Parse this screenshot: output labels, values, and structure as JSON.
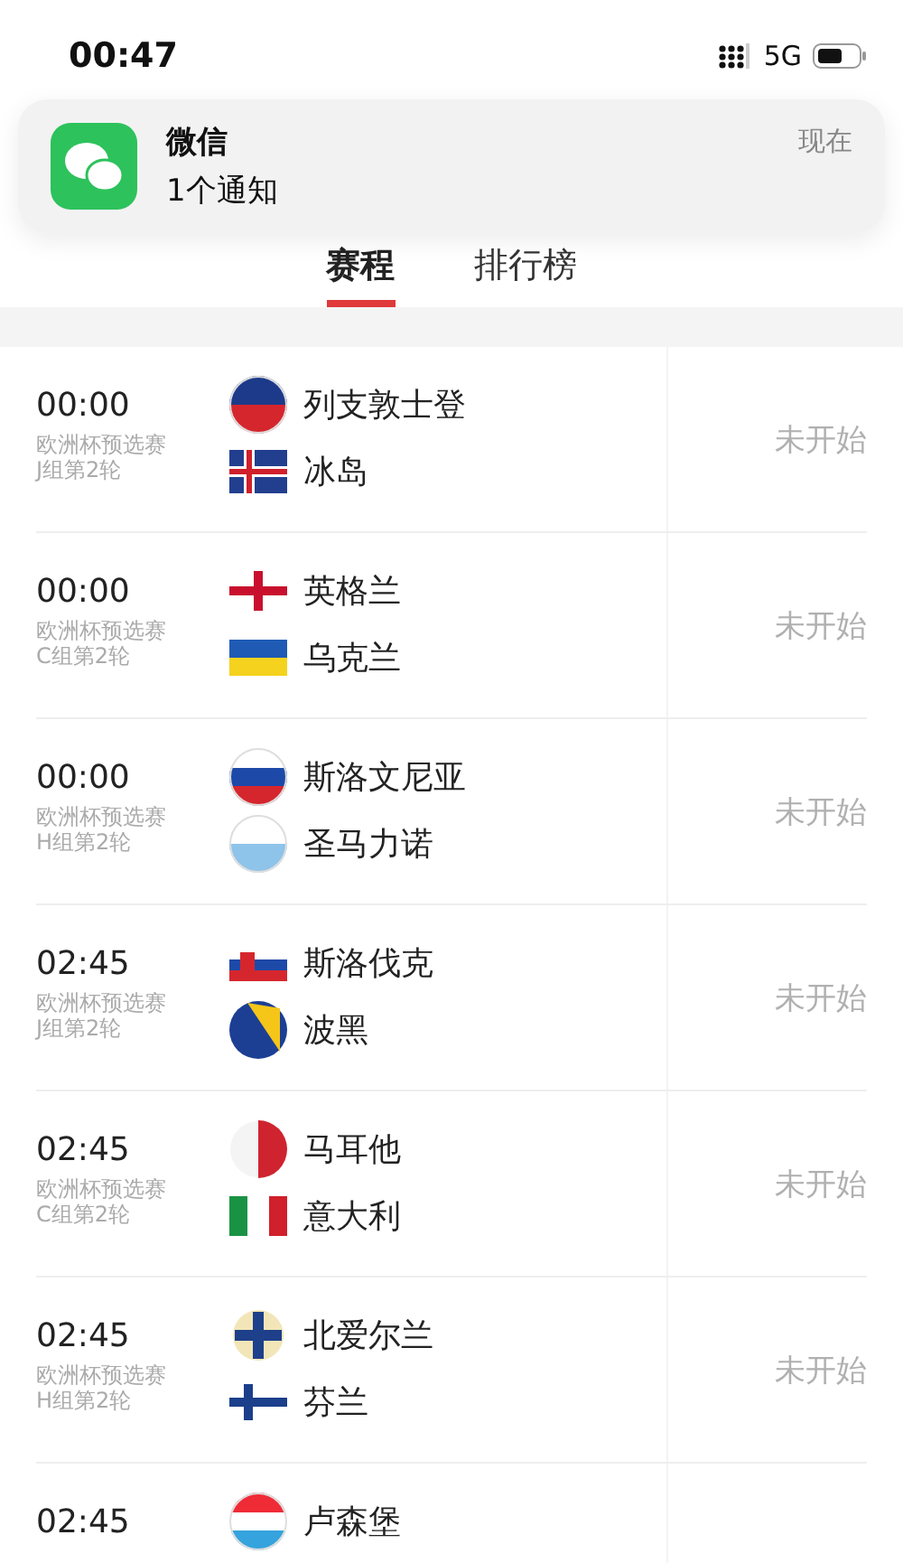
{
  "status_bar": {
    "time": "00:47",
    "network": "5G"
  },
  "notification": {
    "app": "微信",
    "message": "1个通知",
    "time": "现在"
  },
  "tabs": [
    {
      "label": "赛程",
      "selected": true
    },
    {
      "label": "排行榜",
      "selected": false
    }
  ],
  "matches": [
    {
      "time": "00:00",
      "league": "欧洲杯预选赛",
      "round": "J组第2轮",
      "teams": [
        "列支敦士登",
        "冰岛"
      ],
      "status": "未开始"
    },
    {
      "time": "00:00",
      "league": "欧洲杯预选赛",
      "round": "C组第2轮",
      "teams": [
        "英格兰",
        "乌克兰"
      ],
      "status": "未开始"
    },
    {
      "time": "00:00",
      "league": "欧洲杯预选赛",
      "round": "H组第2轮",
      "teams": [
        "斯洛文尼亚",
        "圣马力诺"
      ],
      "status": "未开始"
    },
    {
      "time": "02:45",
      "league": "欧洲杯预选赛",
      "round": "J组第2轮",
      "teams": [
        "斯洛伐克",
        "波黑"
      ],
      "status": "未开始"
    },
    {
      "time": "02:45",
      "league": "欧洲杯预选赛",
      "round": "C组第2轮",
      "teams": [
        "马耳他",
        "意大利"
      ],
      "status": "未开始"
    },
    {
      "time": "02:45",
      "league": "欧洲杯预选赛",
      "round": "H组第2轮",
      "teams": [
        "北爱尔兰",
        "芬兰"
      ],
      "status": "未开始"
    },
    {
      "time": "02:45",
      "teams": [
        "卢森堡"
      ]
    }
  ]
}
